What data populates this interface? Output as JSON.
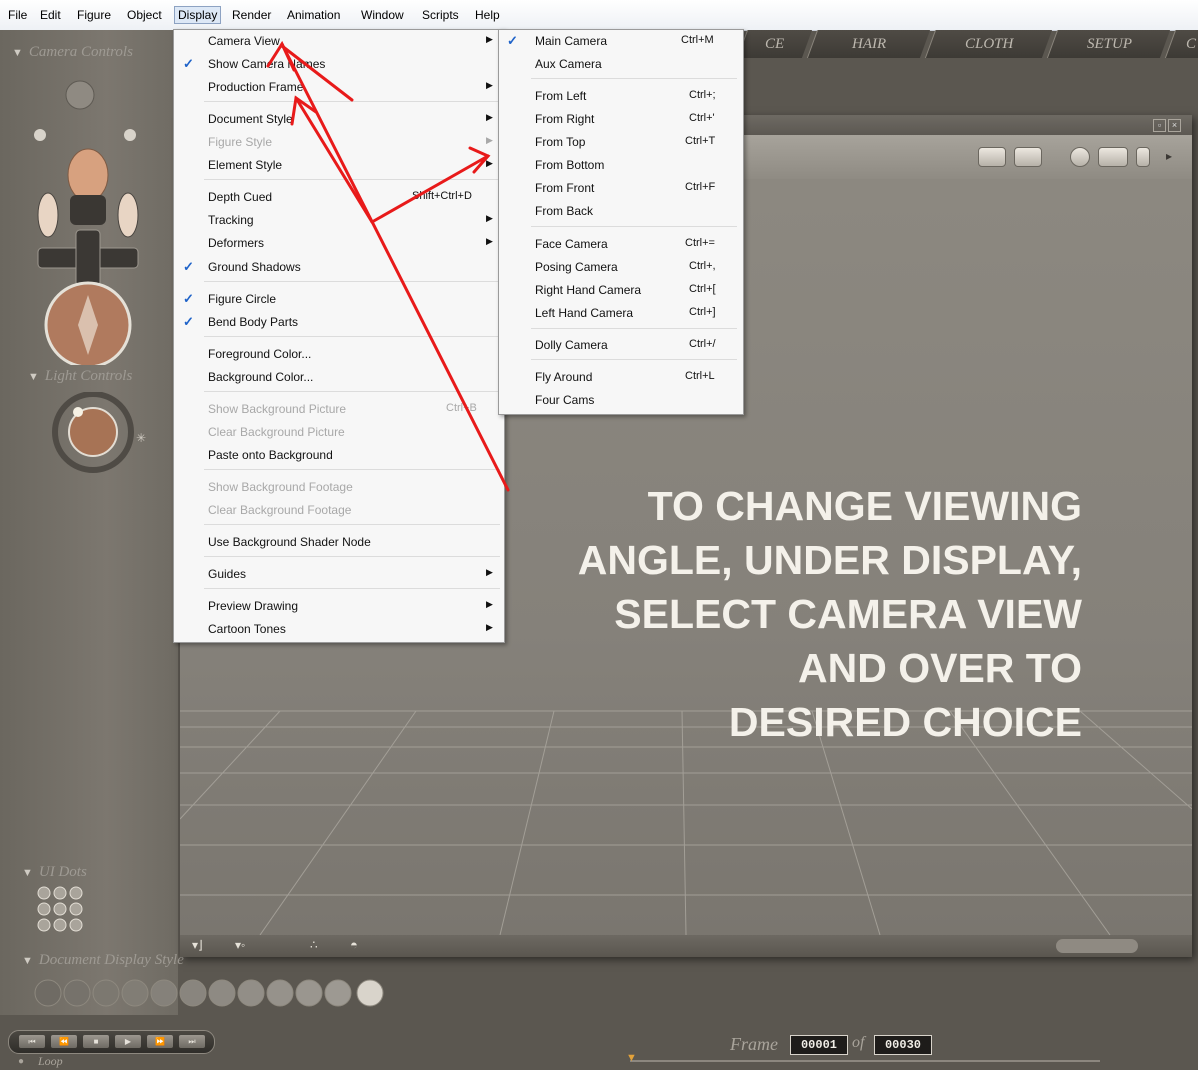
{
  "menubar": {
    "items": [
      "File",
      "Edit",
      "Figure",
      "Object",
      "Display",
      "Render",
      "Animation",
      "Window",
      "Scripts",
      "Help"
    ],
    "active": "Display"
  },
  "left_panel": {
    "camera_controls_label": "Camera Controls",
    "light_controls_label": "Light Controls",
    "ui_dots_label": "UI Dots",
    "document_display_style_label": "Document Display Style"
  },
  "tabs": [
    "CE",
    "HAIR",
    "CLOTH",
    "SETUP",
    "C"
  ],
  "display_menu": {
    "items": [
      {
        "label": "Camera View",
        "submenu": true
      },
      {
        "label": "Show Camera Names",
        "checked": true
      },
      {
        "label": "Production Frame",
        "submenu": true
      },
      {
        "label": "Document Style",
        "submenu": true
      },
      {
        "label": "Figure Style",
        "submenu": true,
        "disabled": true
      },
      {
        "label": "Element Style",
        "submenu": true
      },
      {
        "label": "Depth Cued",
        "shortcut": "Shift+Ctrl+D"
      },
      {
        "label": "Tracking",
        "submenu": true
      },
      {
        "label": "Deformers",
        "submenu": true
      },
      {
        "label": "Ground Shadows",
        "checked": true
      },
      {
        "label": "Figure Circle",
        "checked": true
      },
      {
        "label": "Bend Body Parts",
        "checked": true
      },
      {
        "label": "Foreground Color..."
      },
      {
        "label": "Background Color..."
      },
      {
        "label": "Show Background Picture",
        "shortcut": "Ctrl+B",
        "disabled": true
      },
      {
        "label": "Clear Background Picture",
        "disabled": true
      },
      {
        "label": "Paste onto Background"
      },
      {
        "label": "Show Background Footage",
        "disabled": true
      },
      {
        "label": "Clear Background Footage",
        "disabled": true
      },
      {
        "label": "Use Background Shader Node"
      },
      {
        "label": "Guides",
        "submenu": true
      },
      {
        "label": "Preview Drawing",
        "submenu": true
      },
      {
        "label": "Cartoon Tones",
        "submenu": true
      }
    ]
  },
  "camera_view_submenu": {
    "items": [
      {
        "label": "Main Camera",
        "shortcut": "Ctrl+M",
        "checked": true
      },
      {
        "label": "Aux Camera"
      },
      {
        "label": "From Left",
        "shortcut": "Ctrl+;"
      },
      {
        "label": "From Right",
        "shortcut": "Ctrl+'"
      },
      {
        "label": "From Top",
        "shortcut": "Ctrl+T"
      },
      {
        "label": "From Bottom"
      },
      {
        "label": "From Front",
        "shortcut": "Ctrl+F"
      },
      {
        "label": "From Back"
      },
      {
        "label": "Face Camera",
        "shortcut": "Ctrl+="
      },
      {
        "label": "Posing Camera",
        "shortcut": "Ctrl+,"
      },
      {
        "label": "Right Hand Camera",
        "shortcut": "Ctrl+["
      },
      {
        "label": "Left Hand Camera",
        "shortcut": "Ctrl+]"
      },
      {
        "label": "Dolly Camera",
        "shortcut": "Ctrl+/"
      },
      {
        "label": "Fly Around",
        "shortcut": "Ctrl+L"
      },
      {
        "label": "Four Cams"
      }
    ]
  },
  "overlay": {
    "lines": [
      "TO CHANGE VIEWING",
      "ANGLE, UNDER DISPLAY,",
      "SELECT CAMERA VIEW",
      "AND OVER TO",
      "DESIRED CHOICE"
    ]
  },
  "timeline": {
    "frame_label": "Frame",
    "frame_value": "00001",
    "of_label": "of",
    "total_frames": "00030",
    "loop_label": "Loop"
  },
  "colors": {
    "arrow": "#e81a1a",
    "check": "#1f63c9"
  }
}
